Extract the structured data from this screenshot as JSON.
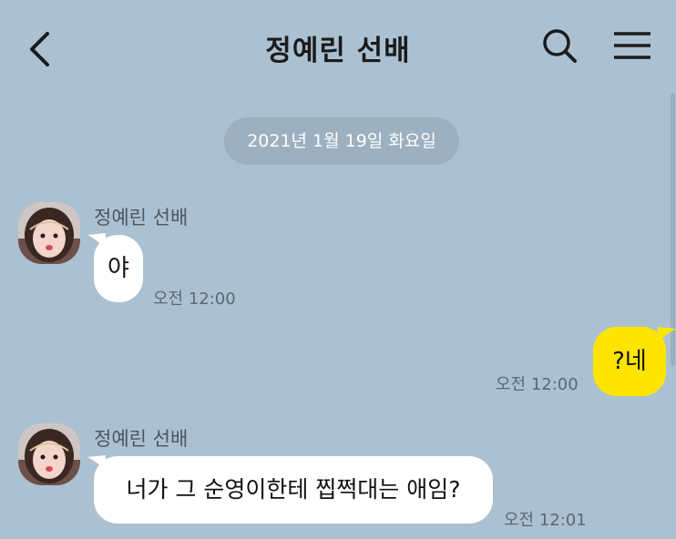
{
  "header": {
    "title": "정예린 선배"
  },
  "date_divider": "2021년 1월 19일 화요일",
  "messages": [
    {
      "sender": "정예린 선배",
      "text": "야",
      "time": "오전 12:00"
    },
    {
      "text": "?네",
      "time": "오전 12:00"
    },
    {
      "sender": "정예린 선배",
      "text": "너가 그 순영이한테 찝쩍대는 애임?",
      "time": "오전 12:01"
    }
  ],
  "colors": {
    "background": "#abc1d1",
    "outgoing_bubble": "#fee500",
    "incoming_bubble": "#ffffff",
    "date_pill": "#9cb0bf"
  },
  "icons": {
    "back": "chevron-left-icon",
    "search": "search-icon",
    "menu": "hamburger-menu-icon"
  }
}
